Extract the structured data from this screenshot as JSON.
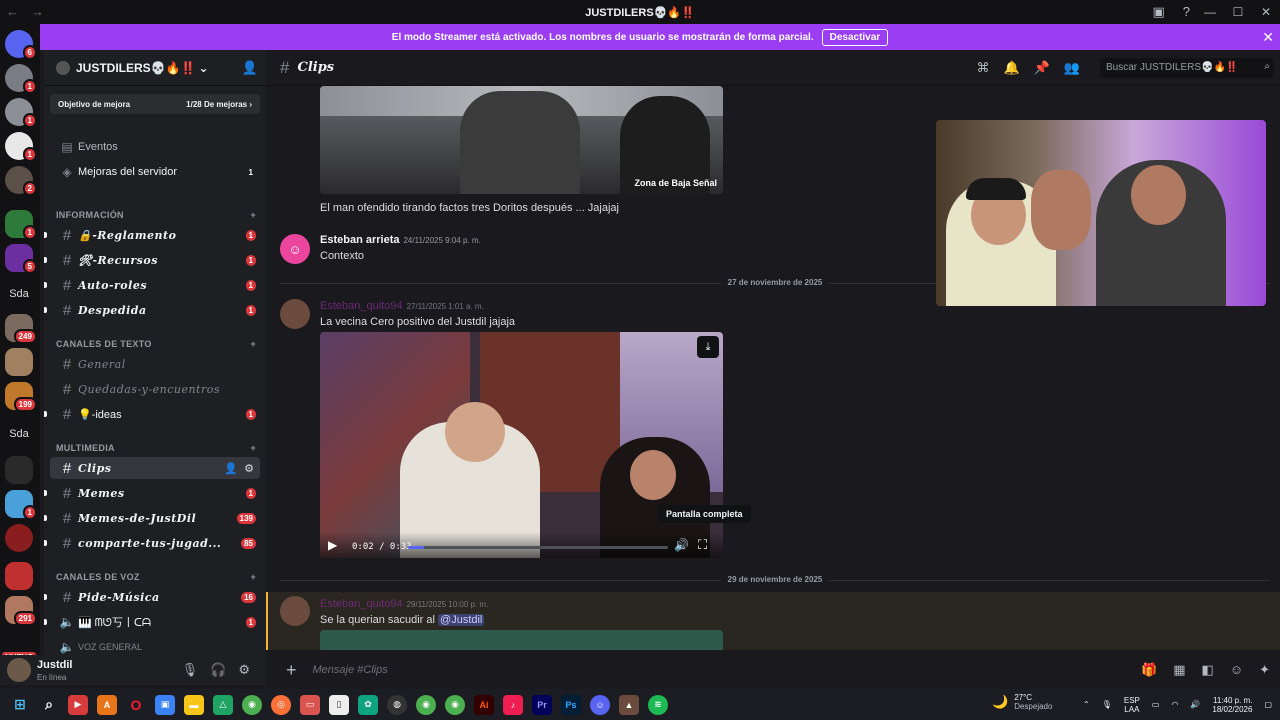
{
  "window": {
    "title": "JUSTDILERS💀🔥‼️"
  },
  "banner": {
    "text": "El modo Streamer está activado. Los nombres de usuario se mostrarán de forma parcial.",
    "button": "Desactivar"
  },
  "guilds": [
    {
      "badge": "6"
    },
    {
      "badge": "1"
    },
    {
      "badge": "1"
    },
    {
      "badge": "1"
    },
    {
      "badge": "2"
    },
    {
      "badge": "1"
    },
    {
      "badge": "5"
    },
    {
      "label": "Sda"
    },
    {
      "badge": "249"
    },
    {
      "badge": ""
    },
    {
      "badge": "199"
    },
    {
      "label": "Sda"
    },
    {
      "badge": ""
    },
    {
      "badge": "1"
    },
    {
      "badge": ""
    },
    {
      "badge": ""
    },
    {
      "badge": "291"
    }
  ],
  "guild_new_label": "NUEVO",
  "server": {
    "name": "JUSTDILERS💀🔥‼️",
    "boost_goal": "Objetivo de mejora",
    "boost_progress": "1/28 De mejoras",
    "events": "Eventos",
    "boosts": "Mejoras del servidor",
    "boosts_count": "1"
  },
  "categories": {
    "info": "INFORMACIÓN",
    "text": "CANALES DE TEXTO",
    "media": "MULTIMEDIA",
    "voice": "CANALES DE VOZ"
  },
  "channels": {
    "reglamento": {
      "name": "🔒-Reglamento",
      "count": "1"
    },
    "recursos": {
      "name": "🛠-Recursos",
      "count": "1"
    },
    "autoroles": {
      "name": "Auto-roles",
      "count": "1"
    },
    "despedida": {
      "name": "Despedida",
      "count": "1"
    },
    "general": {
      "name": "General"
    },
    "quedadas": {
      "name": "Quedadas-y-encuentros"
    },
    "ideas": {
      "name": "💡-ideas",
      "count": "1"
    },
    "clips": {
      "name": "Clips"
    },
    "memes": {
      "name": "Memes",
      "count": "1"
    },
    "memesjd": {
      "name": "Memes-de-JustDil",
      "count": "139"
    },
    "comparte": {
      "name": "comparte-tus-jugad...",
      "count": "85"
    },
    "pidemusica": {
      "name": "Pide-Música",
      "count": "16"
    },
    "musica": {
      "name": "🎹 ᗰᘎ丂丨ᑕᗩ",
      "count": "1"
    },
    "vozgeneral": {
      "name": "VOZ GENERAL"
    }
  },
  "user": {
    "name": "Justdil",
    "status": "En línea"
  },
  "header": {
    "channel": "Clips",
    "search_placeholder": "Buscar JUSTDILERS💀🔥‼️"
  },
  "messages": {
    "m1_caption": "Zona de Baja Señal",
    "m1_text": "El man ofendido tirando factos tres Doritos después ... Jajajaj",
    "m2_user": "Esteban arrieta",
    "m2_time": "24/11/2025 9:04 p. m.",
    "m2_text": "Contexto",
    "sep1": "27 de noviembre de 2025",
    "m3_user": "Esteban_quito94",
    "m3_time": "27/11/2025 1:01 a. m.",
    "m3_text": "La vecina Cero positivo del Justdil jajaja",
    "video_time": "0:02 / 0:33",
    "video_progress": 0.06,
    "tooltip": "Pantalla completa",
    "sep2": "29 de noviembre de 2025",
    "m4_user": "Esteban_quito94",
    "m4_time": "29/11/2025 10:00 p. m.",
    "m4_text": "Se la querian sacudir al",
    "m4_mention": "@Justdil"
  },
  "composer": {
    "placeholder": "Mensaje #Clips"
  },
  "taskbar": {
    "temp": "27°C",
    "weather": "Despejado",
    "lang1": "ESP",
    "lang2": "LAA",
    "time": "11:40 p. m.",
    "date": "18/02/2026"
  },
  "colors": {
    "accent": "#9b3df2",
    "badge": "#da373c",
    "bg": "#1a1a1e"
  }
}
